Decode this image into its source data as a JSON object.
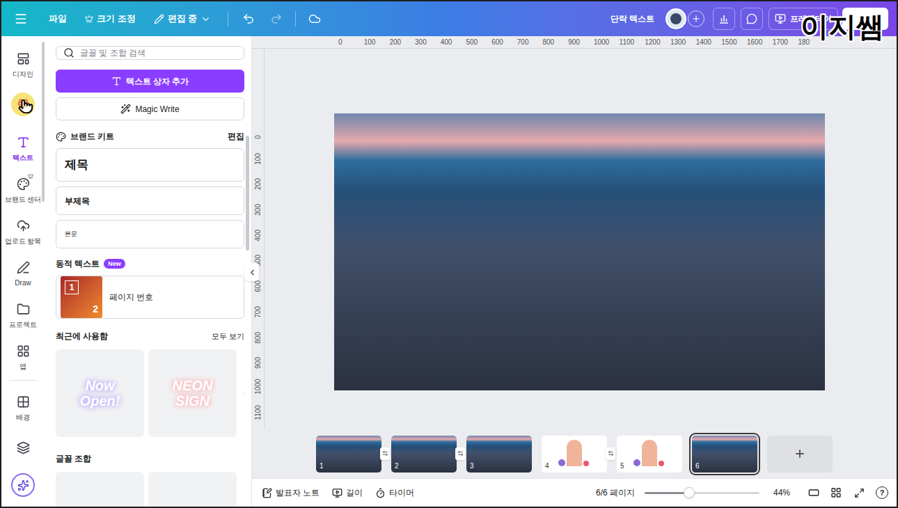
{
  "watermark": "이지쌤",
  "topbar": {
    "menu": [
      {
        "label": "파일",
        "kind": "plain"
      },
      {
        "label": "크기 조정",
        "kind": "crown"
      },
      {
        "label": "편집 중",
        "kind": "dropdown"
      }
    ],
    "selection_label": "단락 텍스트",
    "present_button": "프레젠테이"
  },
  "rail": {
    "items": [
      {
        "label": "디자인",
        "selected": false,
        "hovered": false,
        "premium": false,
        "section": "main"
      },
      {
        "label": "",
        "selected": false,
        "hovered": true,
        "premium": false,
        "section": "main"
      },
      {
        "label": "텍스트",
        "selected": true,
        "hovered": false,
        "premium": false,
        "section": "main"
      },
      {
        "label": "브랜드 센터",
        "selected": false,
        "hovered": false,
        "premium": true,
        "section": "main"
      },
      {
        "label": "업로드 항목",
        "selected": false,
        "hovered": false,
        "premium": false,
        "section": "main"
      },
      {
        "label": "Draw",
        "selected": false,
        "hovered": false,
        "premium": false,
        "section": "main"
      },
      {
        "label": "프로젝트",
        "selected": false,
        "hovered": false,
        "premium": false,
        "section": "main"
      },
      {
        "label": "앱",
        "selected": false,
        "hovered": false,
        "premium": false,
        "section": "main"
      },
      {
        "label": "배경",
        "selected": false,
        "hovered": false,
        "premium": false,
        "section": "extra"
      },
      {
        "label": "",
        "selected": false,
        "hovered": false,
        "premium": false,
        "section": "extra"
      }
    ]
  },
  "panel": {
    "search_placeholder": "글꼴 및 조합 검색",
    "add_text_button": "텍스트 상자 추가",
    "magic_write": "Magic Write",
    "brand_kit": {
      "title": "브랜드 키트",
      "edit": "편집"
    },
    "styles": [
      {
        "label": "제목",
        "kind": "heading"
      },
      {
        "label": "부제목",
        "kind": "subheading"
      },
      {
        "label": "본문",
        "kind": "body"
      }
    ],
    "dynamic": {
      "title": "동적 텍스트",
      "badge": "New",
      "item": "페이지 번호",
      "icon_numbers": [
        "1",
        "2"
      ]
    },
    "recent": {
      "title": "최근에 사용함",
      "more": "모두 보기",
      "items": [
        {
          "text": "Now Open!",
          "color": "#b7a8ff"
        },
        {
          "text": "NEON SIGN",
          "color": "#ffb1b6"
        }
      ]
    },
    "combos_title": "글꼴 조합"
  },
  "rulers": {
    "top": [
      "0",
      "100",
      "200",
      "300",
      "400",
      "500",
      "600",
      "700",
      "800",
      "900",
      "1000",
      "1100",
      "1200",
      "1300",
      "1400",
      "1500",
      "1600",
      "1700",
      "180"
    ],
    "left": [
      "0",
      "100",
      "200",
      "300",
      "400",
      "500",
      "600",
      "700",
      "800",
      "900",
      "1000",
      "1100"
    ]
  },
  "pages": [
    {
      "number": "1",
      "kind": "city",
      "selected": false,
      "transition": true
    },
    {
      "number": "2",
      "kind": "city",
      "selected": false,
      "transition": true
    },
    {
      "number": "3",
      "kind": "city",
      "selected": false,
      "transition": false
    },
    {
      "number": "4",
      "kind": "character",
      "selected": false,
      "transition": true
    },
    {
      "number": "5",
      "kind": "character",
      "selected": false,
      "transition": false
    },
    {
      "number": "6",
      "kind": "city",
      "selected": true,
      "transition": false
    }
  ],
  "bottom_bar": {
    "notes": "발표자 노트",
    "duration": "길이",
    "timer": "타이머",
    "page": "6/6 페이지",
    "zoom_level": 0.39,
    "zoom": "44%",
    "help": "?"
  }
}
